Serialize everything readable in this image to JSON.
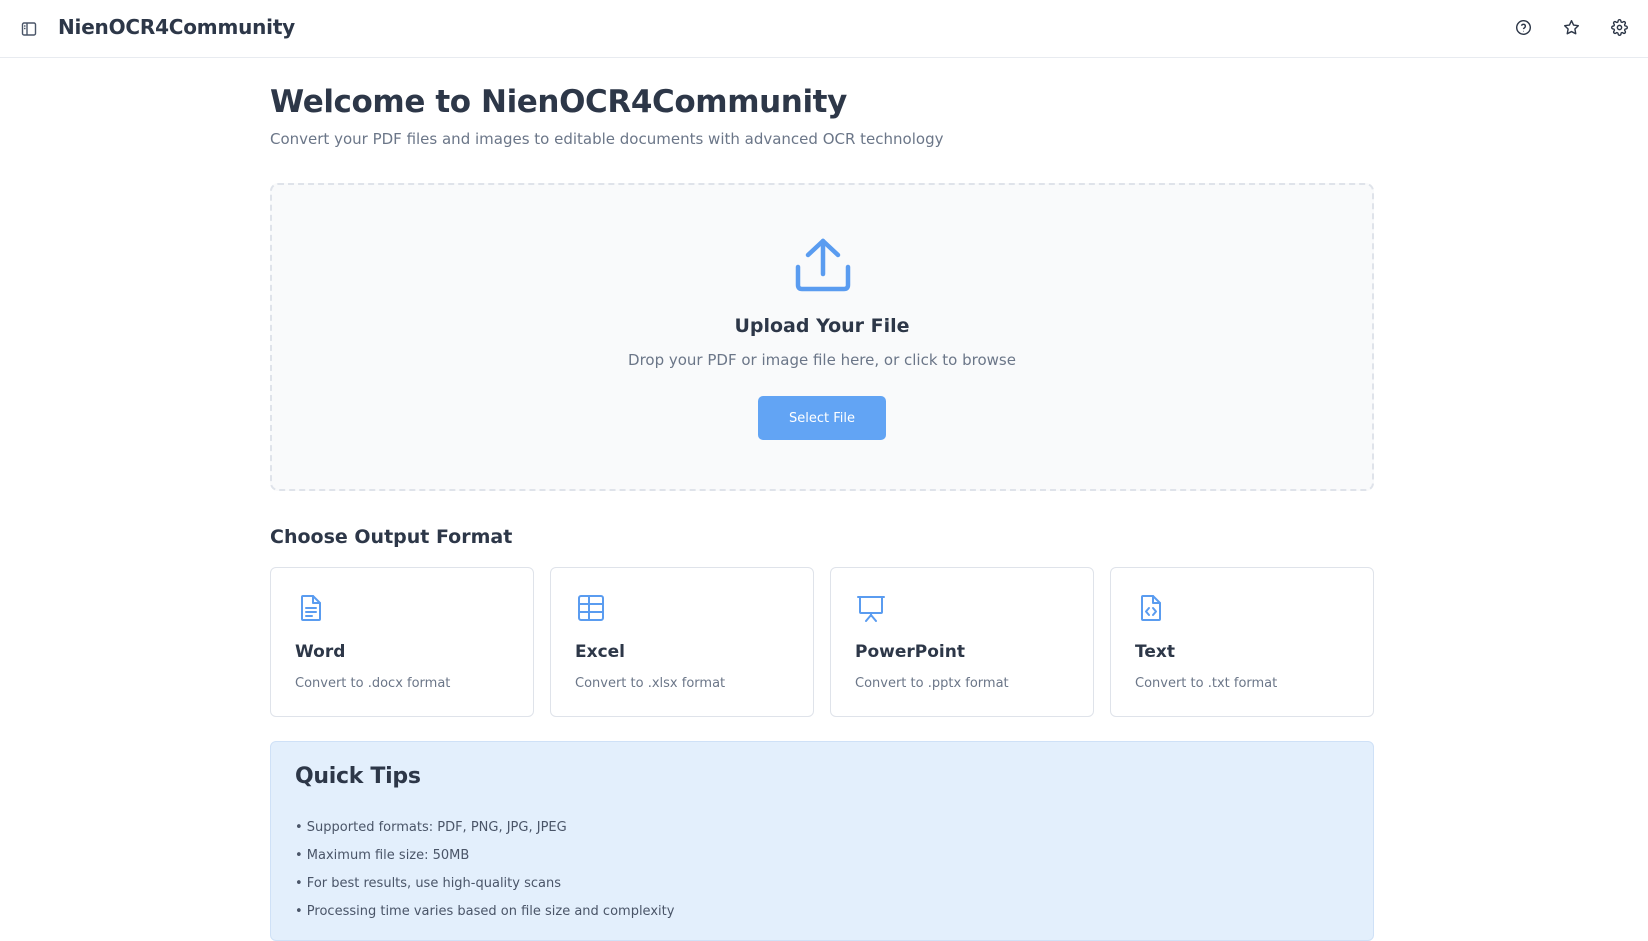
{
  "app": {
    "title": "NienOCR4Community"
  },
  "header": {
    "icons": [
      "sidebar-toggle-icon",
      "help-icon",
      "star-icon",
      "settings-icon"
    ]
  },
  "main": {
    "title": "Welcome to NienOCR4Community",
    "subtitle": "Convert your PDF files and images to editable documents with advanced OCR technology"
  },
  "upload": {
    "icon": "upload-icon",
    "title": "Upload Your File",
    "hint": "Drop your PDF or image file here, or click to browse",
    "button_label": "Select File"
  },
  "formats": {
    "title": "Choose Output Format",
    "items": [
      {
        "name": "Word",
        "desc": "Convert to .docx format",
        "icon": "document-icon"
      },
      {
        "name": "Excel",
        "desc": "Convert to .xlsx format",
        "icon": "table-icon"
      },
      {
        "name": "PowerPoint",
        "desc": "Convert to .pptx format",
        "icon": "presentation-icon"
      },
      {
        "name": "Text",
        "desc": "Convert to .txt format",
        "icon": "code-file-icon"
      }
    ]
  },
  "tips": {
    "title": "Quick Tips",
    "items": [
      "• Supported formats: PDF, PNG, JPG, JPEG",
      "• Maximum file size: 50MB",
      "• For best results, use high-quality scans",
      "• Processing time varies based on file size and complexity"
    ]
  },
  "colors": {
    "accent": "#62a4f4",
    "text_primary": "#2d3748",
    "text_muted": "#6b7688",
    "tips_background": "#e3effc"
  }
}
